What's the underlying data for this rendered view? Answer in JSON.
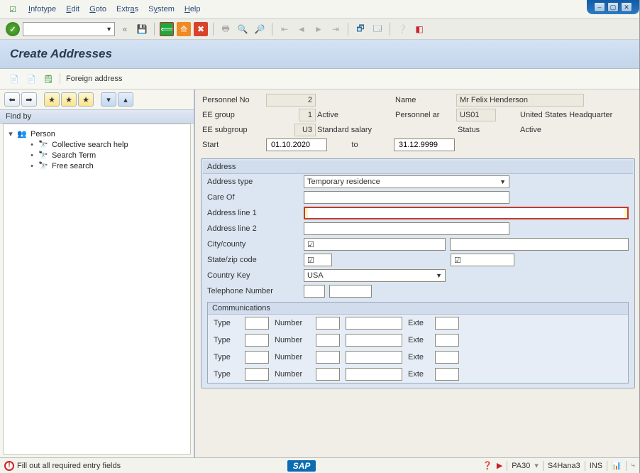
{
  "menu": {
    "infotype": "Infotype",
    "edit": "Edit",
    "goto": "Goto",
    "extras": "Extras",
    "system": "System",
    "help": "Help"
  },
  "page": {
    "title": "Create Addresses",
    "foreign_address": "Foreign address"
  },
  "sidebar": {
    "findby": "Find by",
    "person": "Person",
    "items": [
      "Collective search help",
      "Search Term",
      "Free search"
    ]
  },
  "header": {
    "personnel_no_label": "Personnel No",
    "personnel_no": "2",
    "name_label": "Name",
    "name": "Mr Felix Henderson",
    "ee_group_label": "EE group",
    "ee_group": "1",
    "ee_group_text": "Active",
    "personnel_area_label": "Personnel ar",
    "personnel_area": "US01",
    "personnel_area_text": "United States Headquarter",
    "ee_subgroup_label": "EE subgroup",
    "ee_subgroup": "U3",
    "ee_subgroup_text": "Standard salary",
    "status_label": "Status",
    "status_text": "Active",
    "start_label": "Start",
    "start": "01.10.2020",
    "to_label": "to",
    "end": "31.12.9999"
  },
  "address": {
    "group_title": "Address",
    "address_type_label": "Address type",
    "address_type_value": "Temporary residence",
    "care_of_label": "Care Of",
    "care_of": "",
    "line1_label": "Address line 1",
    "line1": "",
    "line2_label": "Address line 2",
    "line2": "",
    "city_label": "City/county",
    "city": "",
    "county": "",
    "state_label": "State/zip code",
    "state": "",
    "zip": "",
    "country_label": "Country Key",
    "country": "USA",
    "telephone_label": "Telephone Number",
    "telephone_a": "",
    "telephone_b": ""
  },
  "comms": {
    "title": "Communications",
    "type_label": "Type",
    "number_label": "Number",
    "ext_label": "Exte"
  },
  "status": {
    "message": "Fill out all required entry fields",
    "sap": "SAP",
    "tcode": "PA30",
    "system": "S4Hana3",
    "ins": "INS"
  }
}
